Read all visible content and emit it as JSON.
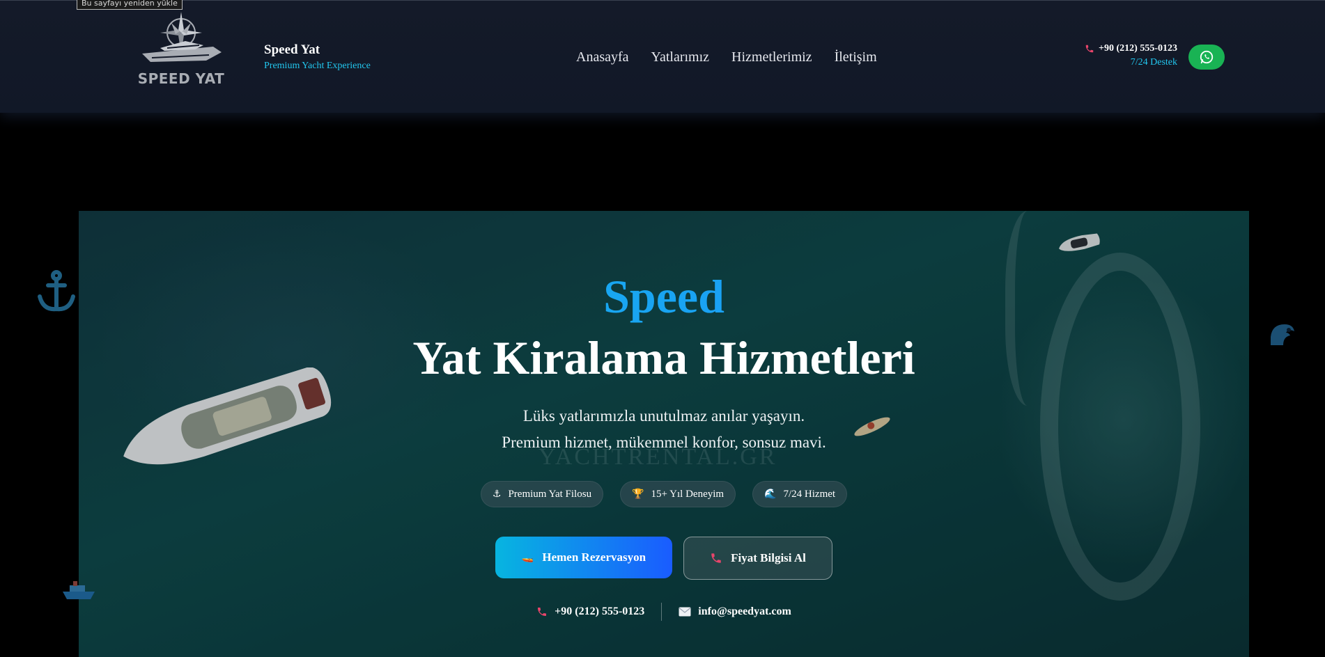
{
  "tooltip": "Bu sayfayı yeniden yükle",
  "brand": {
    "logo_text": "SPEED YAT",
    "name": "Speed Yat",
    "tagline": "Premium Yacht Experience"
  },
  "nav": {
    "items": [
      {
        "label": "Anasayfa"
      },
      {
        "label": "Yatlarımız"
      },
      {
        "label": "Hizmetlerimiz"
      },
      {
        "label": "İletişim"
      }
    ]
  },
  "header_contact": {
    "phone": "+90 (212) 555-0123",
    "support": "7/24 Destek",
    "whatsapp_icon": "whatsapp-icon"
  },
  "hero": {
    "watermark": "YACHTRENTAL.GR",
    "title_accent": "Speed",
    "title": "Yat Kiralama Hizmetleri",
    "subtitle_line1": "Lüks yatlarımızla unutulmaz anılar yaşayın.",
    "subtitle_line2": "Premium hizmet, mükemmel konfor, sonsuz mavi.",
    "badges": [
      {
        "icon": "⚓",
        "label": "Premium Yat Filosu"
      },
      {
        "icon": "🏆",
        "label": "15+ Yıl Deneyim"
      },
      {
        "icon": "🌊",
        "label": "7/24 Hizmet"
      }
    ],
    "primary_cta": {
      "icon": "🚤",
      "label": "Hemen Rezervasyon"
    },
    "secondary_cta": {
      "icon": "📞",
      "label": "Fiyat Bilgisi Al"
    },
    "contact_phone": "+90 (212) 555-0123",
    "contact_email": "info@speedyat.com"
  },
  "colors": {
    "accent_cyan": "#22c7ef",
    "accent_blue": "#1a5cff",
    "whatsapp_green": "#19b354",
    "header_bg": "#111827",
    "phone_icon_pink": "#e8456b"
  }
}
